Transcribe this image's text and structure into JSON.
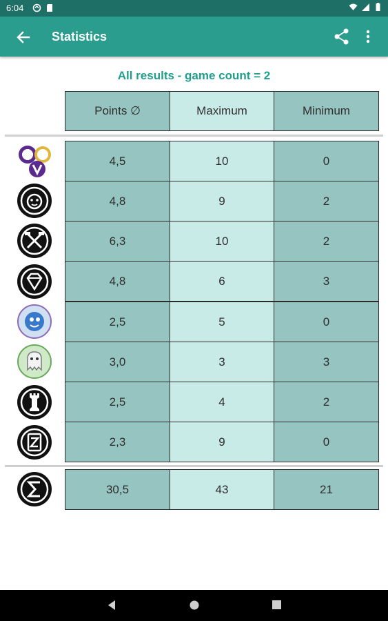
{
  "status_bar": {
    "time": "6:04"
  },
  "toolbar": {
    "title": "Statistics"
  },
  "subtitle": "All results - game count = 2",
  "table": {
    "headers": [
      "Points ∅",
      "Maximum",
      "Minimum"
    ],
    "rows": [
      {
        "icon": "purple-circles-icon",
        "avg": "4,5",
        "max": "10",
        "min": "0"
      },
      {
        "icon": "lion-face-icon",
        "avg": "4,8",
        "max": "9",
        "min": "2"
      },
      {
        "icon": "crossed-tools-icon",
        "avg": "6,3",
        "max": "10",
        "min": "2"
      },
      {
        "icon": "diamond-icon",
        "avg": "4,8",
        "max": "6",
        "min": "3"
      },
      {
        "icon": "blue-creature-icon",
        "avg": "2,5",
        "max": "5",
        "min": "0"
      },
      {
        "icon": "green-ghost-icon",
        "avg": "3,0",
        "max": "3",
        "min": "3"
      },
      {
        "icon": "chess-rook-icon",
        "avg": "2,5",
        "max": "4",
        "min": "2"
      },
      {
        "icon": "scroll-z-icon",
        "avg": "2,3",
        "max": "9",
        "min": "0"
      }
    ],
    "total": {
      "icon": "sigma-icon",
      "avg": "30,5",
      "max": "43",
      "min": "21"
    }
  },
  "colors": {
    "status_bar": "#1e6f66",
    "toolbar": "#2a9d8f",
    "accent_text": "#1f9e8c",
    "col_dark": "#95c4c1",
    "col_light": "#c8ebe8"
  }
}
